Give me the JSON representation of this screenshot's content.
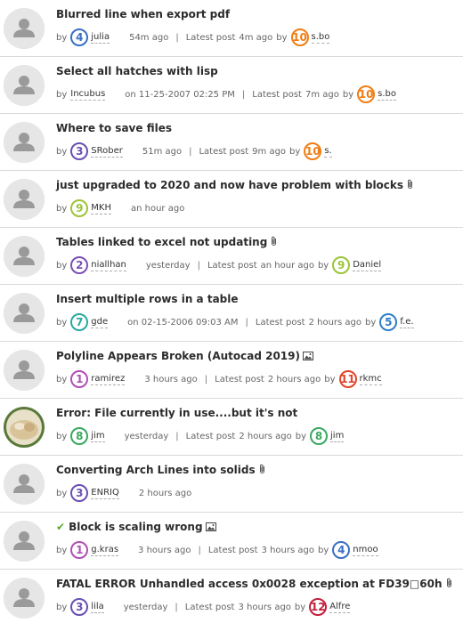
{
  "labels": {
    "by": "by",
    "latest_post": "Latest post",
    "sep": "|"
  },
  "rows": [
    {
      "title": "Blurred line when export pdf",
      "attach": "",
      "author": "julia",
      "author_rank": "4",
      "author_color": "#3a6fc4",
      "time": "54m ago",
      "latest": "4m ago",
      "last_user": "s.bo",
      "last_rank": "10",
      "last_color": "#f07d16",
      "accepted": false
    },
    {
      "title": "Select all hatches with lisp",
      "attach": "",
      "author": "Incubus",
      "author_rank": "",
      "author_color": "",
      "time": "on 11-25-2007 02:25 PM",
      "latest": "7m ago",
      "last_user": "s.bo",
      "last_rank": "10",
      "last_color": "#f07d16",
      "accepted": false
    },
    {
      "title": "Where to save files",
      "attach": "",
      "author": "SRober",
      "author_rank": "3",
      "author_color": "#6a4fb4",
      "time": "51m ago",
      "latest": "9m ago",
      "last_user": "s.",
      "last_rank": "10",
      "last_color": "#f07d16",
      "accepted": false
    },
    {
      "title": "just upgraded to 2020 and now have problem with blocks",
      "attach": "clip",
      "author": "MKH",
      "author_rank": "9",
      "author_color": "#9cc43a",
      "time": "an hour ago",
      "latest": "",
      "last_user": "",
      "last_rank": "",
      "last_color": "",
      "accepted": false
    },
    {
      "title": "Tables linked to excel not updating",
      "attach": "clip",
      "author": "niallhan",
      "author_rank": "2",
      "author_color": "#7a4fb4",
      "time": "yesterday",
      "latest": "an hour ago",
      "last_user": "Daniel",
      "last_rank": "9",
      "last_color": "#9cc43a",
      "accepted": false
    },
    {
      "title": "Insert multiple rows in a table",
      "attach": "",
      "author": "gde",
      "author_rank": "7",
      "author_color": "#2aa9a0",
      "time": "on 02-15-2006 09:03 AM",
      "latest": "2 hours ago",
      "last_user": "f.e.",
      "last_rank": "5",
      "last_color": "#2f7fc8",
      "accepted": false
    },
    {
      "title": "Polyline Appears Broken (Autocad 2019)",
      "attach": "image",
      "author": "ramirez",
      "author_rank": "1",
      "author_color": "#b04fb4",
      "time": "3 hours ago",
      "latest": "2 hours ago",
      "last_user": "rkmc",
      "last_rank": "11",
      "last_color": "#e0452a",
      "accepted": false
    },
    {
      "title": "Error: File currently in use....but it's not",
      "attach": "",
      "author": "jim",
      "author_rank": "8",
      "author_color": "#3aa860",
      "time": "yesterday",
      "latest": "2 hours ago",
      "last_user": "jim",
      "last_rank": "8",
      "last_color": "#3aa860",
      "accepted": false,
      "photo": true
    },
    {
      "title": "Converting Arch Lines into solids",
      "attach": "clip",
      "author": "ENRIQ",
      "author_rank": "3",
      "author_color": "#6a4fb4",
      "time": "2 hours ago",
      "latest": "",
      "last_user": "",
      "last_rank": "",
      "last_color": "",
      "accepted": false
    },
    {
      "title": "Block is scaling wrong",
      "attach": "image",
      "author": "g.kras",
      "author_rank": "1",
      "author_color": "#b04fb4",
      "time": "3 hours ago",
      "latest": "3 hours ago",
      "last_user": "nmoo",
      "last_rank": "4",
      "last_color": "#3a6fc4",
      "accepted": true
    },
    {
      "title": "FATAL ERROR Unhandled access 0x0028 exception at FD39□60h",
      "attach": "clip",
      "author": "lila",
      "author_rank": "3",
      "author_color": "#6a4fb4",
      "time": "yesterday",
      "latest": "3 hours ago",
      "last_user": "Alfre",
      "last_rank": "12",
      "last_color": "#c41e3a",
      "accepted": false
    }
  ]
}
